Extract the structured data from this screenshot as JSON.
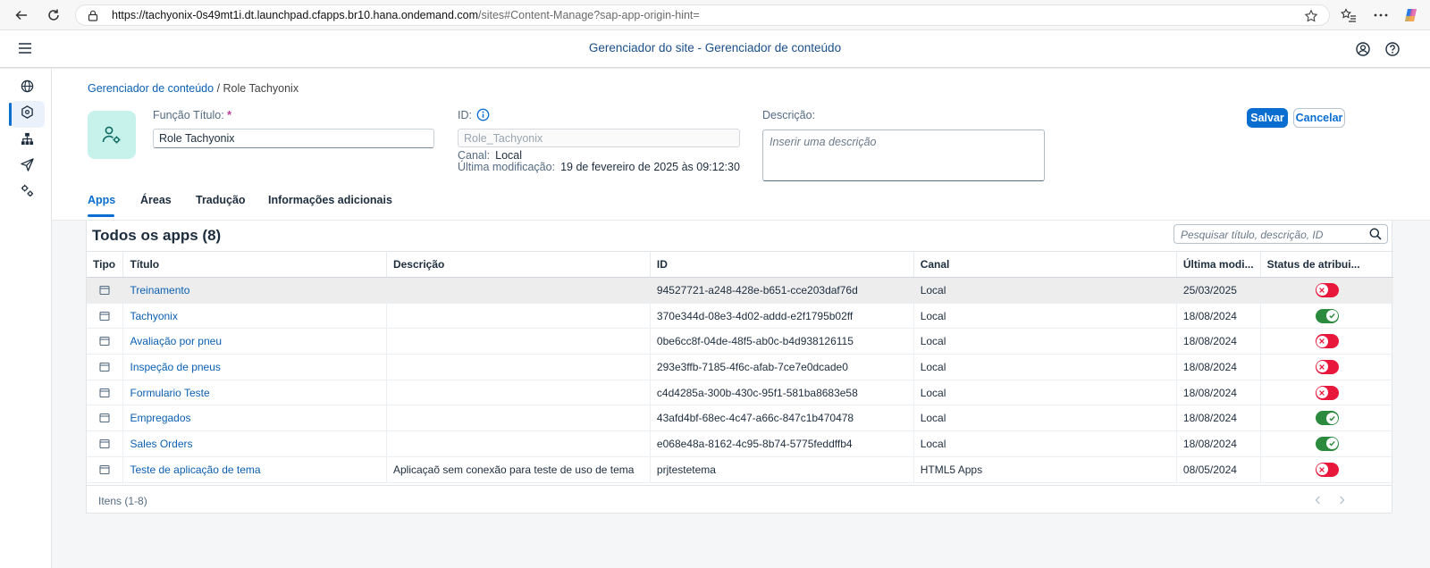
{
  "browser": {
    "url_host": "https://tachyonix-0s49mt1i.dt.launchpad.cfapps.br10.hana.ondemand.com",
    "url_path": "/sites#Content-Manage?sap-app-origin-hint="
  },
  "shell": {
    "title": "Gerenciador do site - Gerenciador de conteúdo"
  },
  "breadcrumb": {
    "parent": "Gerenciador de conteúdo",
    "separator": "/",
    "current": "Role Tachyonix"
  },
  "form": {
    "title_label": "Função Título:",
    "title_required": "*",
    "title_value": "Role Tachyonix",
    "id_label": "ID:",
    "id_value": "Role_Tachyonix",
    "channel_label": "Canal:",
    "channel_value": "Local",
    "modified_label": "Última modificação:",
    "modified_value": "19 de fevereiro de 2025 às 09:12:30",
    "description_label": "Descrição:",
    "description_placeholder": "Inserir uma descrição"
  },
  "actions": {
    "save": "Salvar",
    "cancel": "Cancelar"
  },
  "tabs": [
    {
      "label": "Apps"
    },
    {
      "label": "Áreas"
    },
    {
      "label": "Tradução"
    },
    {
      "label": "Informações adicionais"
    }
  ],
  "table": {
    "title": "Todos os apps (8)",
    "search_placeholder": "Pesquisar título, descrição, ID",
    "columns": [
      "Tipo",
      "Título",
      "Descrição",
      "ID",
      "Canal",
      "Última modi...",
      "Status de atribui..."
    ],
    "rows": [
      {
        "title": "Treinamento",
        "description": "",
        "id": "94527721-a248-428e-b651-cce203daf76d",
        "channel": "Local",
        "modified": "25/03/2025",
        "assigned": false
      },
      {
        "title": "Tachyonix",
        "description": "",
        "id": "370e344d-08e3-4d02-addd-e2f1795b02ff",
        "channel": "Local",
        "modified": "18/08/2024",
        "assigned": true
      },
      {
        "title": "Avaliação por pneu",
        "description": "",
        "id": "0be6cc8f-04de-48f5-ab0c-b4d938126115",
        "channel": "Local",
        "modified": "18/08/2024",
        "assigned": false
      },
      {
        "title": "Inspeção de pneus",
        "description": "",
        "id": "293e3ffb-7185-4f6c-afab-7ce7e0dcade0",
        "channel": "Local",
        "modified": "18/08/2024",
        "assigned": false
      },
      {
        "title": "Formulario Teste",
        "description": "",
        "id": "c4d4285a-300b-430c-95f1-581ba8683e58",
        "channel": "Local",
        "modified": "18/08/2024",
        "assigned": false
      },
      {
        "title": "Empregados",
        "description": "",
        "id": "43afd4bf-68ec-4c47-a66c-847c1b470478",
        "channel": "Local",
        "modified": "18/08/2024",
        "assigned": true
      },
      {
        "title": "Sales Orders",
        "description": "",
        "id": "e068e48a-8162-4c95-8b74-5775feddffb4",
        "channel": "Local",
        "modified": "18/08/2024",
        "assigned": true
      },
      {
        "title": "Teste de aplicação de tema",
        "description": "Aplicaçaõ sem conexão para teste de uso de tema",
        "id": "prjtestetema",
        "channel": "HTML5 Apps",
        "modified": "08/05/2024",
        "assigned": false
      }
    ],
    "footer": "Itens (1-8)"
  },
  "colors": {
    "accent": "#0a6ed1",
    "unassigned": "#e8173c",
    "assigned": "#2b8a3e",
    "avatar_bg": "#c7f2ec"
  }
}
